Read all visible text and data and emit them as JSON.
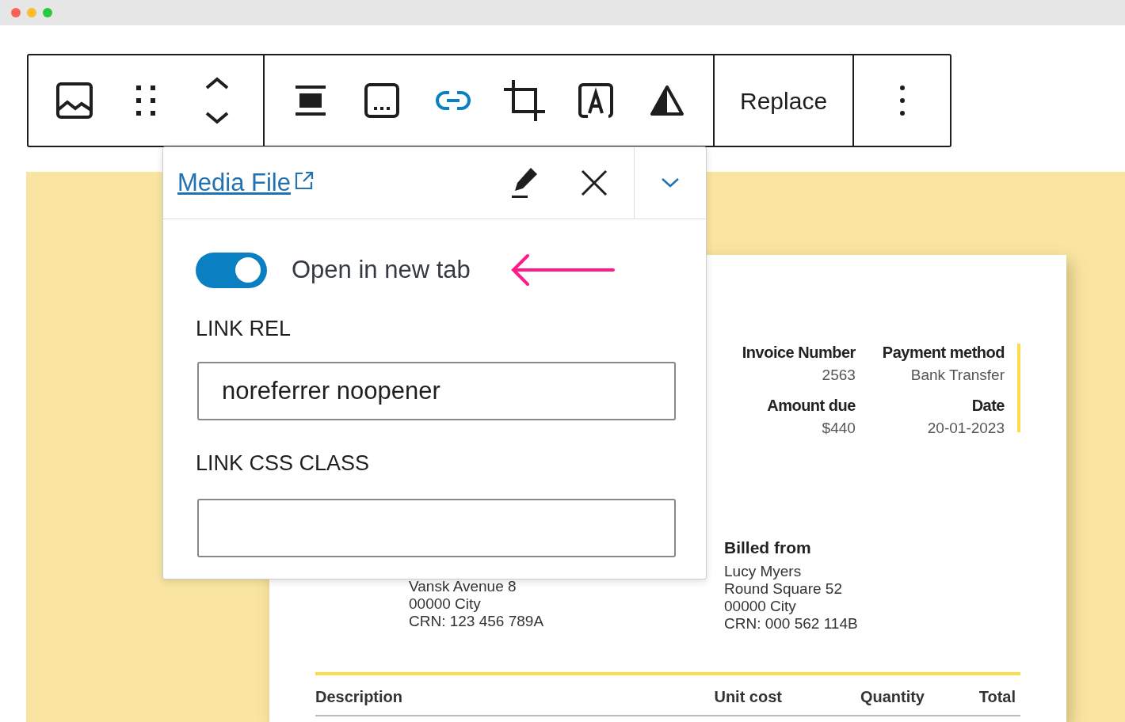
{
  "toolbar": {
    "groups": [
      {
        "tools": [
          {
            "kind": "image",
            "selected": false
          },
          {
            "kind": "drag",
            "selected": false
          },
          {
            "kind": "mover",
            "selected": false
          }
        ]
      },
      {
        "tools": [
          {
            "kind": "align",
            "selected": false
          },
          {
            "kind": "caption",
            "selected": false
          },
          {
            "kind": "link",
            "selected": true
          },
          {
            "kind": "crop",
            "selected": false
          },
          {
            "kind": "text",
            "selected": false
          },
          {
            "kind": "duotone",
            "selected": false
          }
        ]
      }
    ],
    "replace_button": "Replace"
  },
  "link_popover": {
    "link_text": "Media File",
    "open_in_new_tab": true,
    "toggle_label": "Open in new tab",
    "rel_label": "LINK REL",
    "rel_value": "noreferrer noopener",
    "class_label": "LINK CSS CLASS"
  },
  "invoice": {
    "meta": [
      {
        "label": "Invoice Number",
        "value": "2563"
      },
      {
        "label": "Payment method",
        "value": "Bank Transfer"
      },
      {
        "label": "Amount due",
        "value": "$440"
      },
      {
        "label": "Date",
        "value": "20-01-2023"
      }
    ],
    "billed_to_lines": [
      "Vansk Avenue 8",
      "00000 City",
      "CRN: 123 456 789A"
    ],
    "billed_from": {
      "heading": "Billed from",
      "lines": [
        "Lucy Myers",
        "Round Square 52",
        "00000 City",
        "CRN: 000 562 114B"
      ]
    },
    "table_columns": [
      "Description",
      "Unit cost",
      "Quantity",
      "Total"
    ]
  }
}
